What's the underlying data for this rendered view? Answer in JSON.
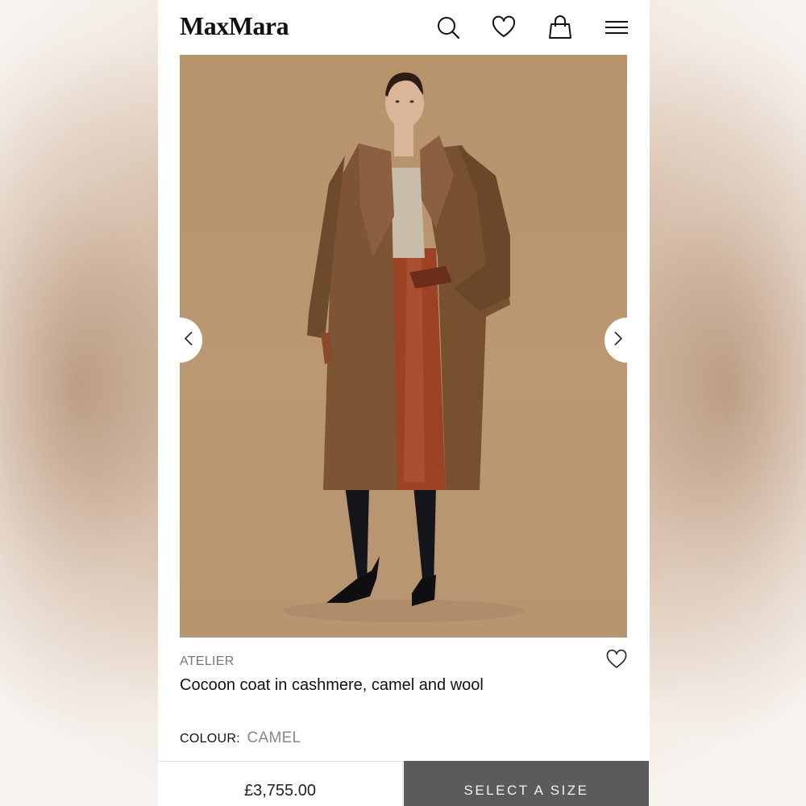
{
  "header": {
    "logo": "MaxMara",
    "icons": [
      "search-icon",
      "heart-icon",
      "shopping-bag-icon",
      "menu-icon"
    ]
  },
  "gallery": {
    "prev_icon": "chevron-left-icon",
    "next_icon": "chevron-right-icon"
  },
  "product": {
    "line": "ATELIER",
    "name": "Cocoon coat in cashmere, camel and wool",
    "colour_label": "COLOUR:",
    "colour_value": "CAMEL",
    "price": "£3,755.00",
    "cta": "SELECT A SIZE",
    "wishlist_icon": "heart-outline-icon"
  },
  "colors": {
    "accent_button": "#5b5b5b",
    "hero_background": "#b7936c"
  }
}
